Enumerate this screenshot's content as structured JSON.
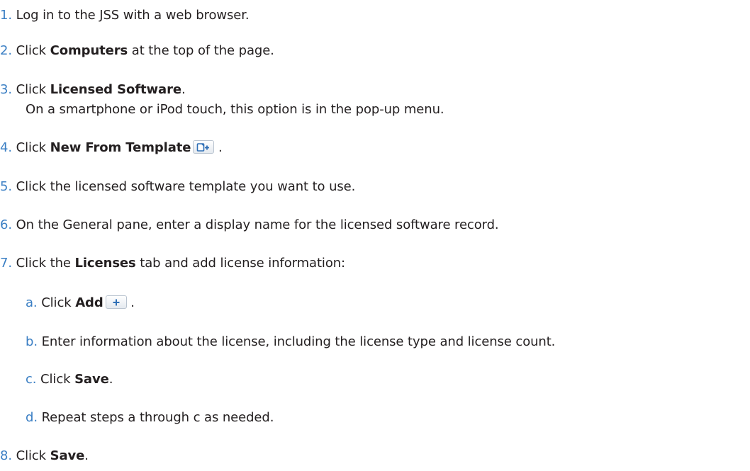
{
  "steps": [
    {
      "num": "1.",
      "parts": [
        "Log in to the JSS with a web browser."
      ]
    },
    {
      "num": "2.",
      "pre": "Click ",
      "bold": "Computers",
      "post": " at the top of the page."
    },
    {
      "num": "3.",
      "pre": "Click ",
      "bold": "Licensed Software",
      "post": ".",
      "note": "On a smartphone or iPod touch, this option is in the pop-up menu."
    },
    {
      "num": "4.",
      "pre": "Click ",
      "bold": "New From Template",
      "post": " .",
      "icon": "new-from-template-icon"
    },
    {
      "num": "5.",
      "text": "Click the licensed software template you want to use."
    },
    {
      "num": "6.",
      "text": "On the General pane, enter a display name for the licensed software record."
    },
    {
      "num": "7.",
      "pre": "Click the ",
      "bold": "Licenses",
      "post": " tab and add license information:"
    },
    {
      "num": "8.",
      "pre": "Click ",
      "bold": "Save",
      "post": "."
    }
  ],
  "substeps": [
    {
      "letter": "a.",
      "pre": "Click ",
      "bold": "Add",
      "post": " .",
      "icon": "add-plus-icon"
    },
    {
      "letter": "b.",
      "text": "Enter information about the license, including the license type and license count."
    },
    {
      "letter": "c.",
      "pre": "Click ",
      "bold": "Save",
      "post": "."
    },
    {
      "letter": "d.",
      "text": "Repeat steps a through c as needed."
    }
  ],
  "colors": {
    "number": "#3b7fc4",
    "text": "#231f20"
  }
}
